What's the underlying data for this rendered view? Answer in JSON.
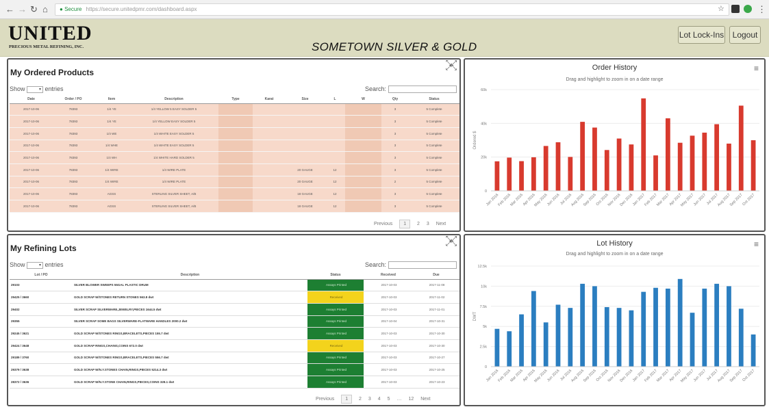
{
  "browser": {
    "secure_label": "Secure",
    "url": "https://secure.unitedpmr.com/dashboard.aspx"
  },
  "header": {
    "logo": "UNITED",
    "logo_sub": "PRECIOUS METAL REFINING, INC.",
    "store_name": "SOMETOWN SILVER & GOLD",
    "lot_lockins_btn": "Lot Lock-Ins",
    "logout_btn": "Logout"
  },
  "products": {
    "title": "My Ordered Products",
    "show_label": "Show",
    "entries_label": "entries",
    "search_label": "Search:",
    "columns": [
      "Date",
      "Order / PO",
      "Item",
      "Description",
      "Type",
      "Karat",
      "Size",
      "L",
      "W",
      "Qty",
      "Status"
    ],
    "rows": [
      [
        "2017-10-06",
        "78393",
        "1/4 YE",
        "1/4 YELLOW 5 EASY SOLDER 5",
        "",
        "",
        "",
        "",
        "",
        "3",
        "5 Complete"
      ],
      [
        "2017-10-06",
        "78393",
        "1/4 YE",
        "1/4 YELLOW EASY SOLDER 5",
        "",
        "",
        "",
        "",
        "",
        "3",
        "5 Complete"
      ],
      [
        "2017-10-06",
        "78393",
        "1/4 WE",
        "1/4 WHITE EASY SOLDER 5",
        "",
        "",
        "",
        "",
        "",
        "3",
        "5 Complete"
      ],
      [
        "2017-10-06",
        "78393",
        "1/4 WHE",
        "1/4 WHITE EASY SOLDER 5",
        "",
        "",
        "",
        "",
        "",
        "3",
        "5 Complete"
      ],
      [
        "2017-10-06",
        "78393",
        "1/4 WH",
        "1/4 WHITE HARD SOLDER 5",
        "",
        "",
        "",
        "",
        "",
        "3",
        "5 Complete"
      ],
      [
        "2017-10-06",
        "78393",
        "1/4 WIRE",
        "1/4 WIRE PLATE",
        "",
        "",
        "20 GAUGE",
        "12",
        "",
        "3",
        "5 Complete"
      ],
      [
        "2017-10-06",
        "78393",
        "1/4 WIRE",
        "1/4 WIRE PLATE",
        "",
        "",
        "20 GAUGE",
        "12",
        "",
        "2",
        "5 Complete"
      ],
      [
        "2017-10-06",
        "78393",
        "AGSS",
        "STERLING SILVER SHEET, A/B",
        "",
        "",
        "18 GAUGE",
        "12",
        "",
        "3",
        "5 Complete"
      ],
      [
        "2017-10-06",
        "78393",
        "AGSS",
        "STERLING SILVER SHEET, A/B",
        "",
        "",
        "18 GAUGE",
        "12",
        "",
        "3",
        "5 Complete"
      ]
    ],
    "pager": {
      "previous": "Previous",
      "pages": [
        "1",
        "2",
        "3"
      ],
      "next": "Next"
    }
  },
  "lots": {
    "title": "My Refining Lots",
    "show_label": "Show",
    "entries_label": "entries",
    "search_label": "Search:",
    "columns": [
      "Lot / PO",
      "Description",
      "Status",
      "Received",
      "Due"
    ],
    "rows": [
      [
        "29103",
        "SILVER BLOWER SWEEPS 55GAL PLASTIC DRUM",
        "Assays Printed",
        "2017-10-03",
        "2017-11-08"
      ],
      [
        "29425 / 3660",
        "GOLD SCRAP W/STONES RETURN STONES 563.8 dwt",
        "Received",
        "2017-10-03",
        "2017-11-02"
      ],
      [
        "29402",
        "SILVER SCRAP SILVERWARE,JEWELRY,PIECES 1644.5 dwt",
        "Assays Printed",
        "2017-10-03",
        "2017-11-01"
      ],
      [
        "29355",
        "SILVER SCRAP SOME BAGS SILVERWARE-FLATWARE HANDLES 2000.2 dwt",
        "Assays Printed",
        "2017-10-04",
        "2017-10-31"
      ],
      [
        "29245 / 3621",
        "GOLD SCRAP W/STONES RINGS,BRACELETS,PIECES 155.7 dwt",
        "Assays Printed",
        "2017-10-03",
        "2017-10-30"
      ],
      [
        "29424 / 3648",
        "GOLD SCRAP RINGS,CHAINS,COINS 672.0 dwt",
        "Received",
        "2017-10-03",
        "2017-10-30"
      ],
      [
        "29189 / 3760",
        "GOLD SCRAP W/STONES RINGS,BRACELETS,PIECES 556.7 dwt",
        "Assays Printed",
        "2017-10-03",
        "2017-10-27"
      ],
      [
        "29379 / 3638",
        "GOLD SCRAP W/N.Y.STONES CHAIN,RINGS,PIECES 5214.3 dwt",
        "Assays Printed",
        "2017-10-03",
        "2017-10-25"
      ],
      [
        "28372 / 3636",
        "GOLD SCRAP W/N.Y.STONE CHAIN,RINGS,PIECES,COINS 328.1 dwt",
        "Assays Printed",
        "2017-10-03",
        "2017-10-23"
      ]
    ],
    "pager": {
      "previous": "Previous",
      "pages": [
        "1",
        "2",
        "3",
        "4",
        "5",
        "…",
        "12"
      ],
      "next": "Next"
    }
  },
  "colors": {
    "order_bar": "#d83a2e",
    "lot_bar": "#2b7ec0",
    "green_status": "#1d7f32",
    "yellow_status": "#f3d31c"
  },
  "chart_data": [
    {
      "type": "bar",
      "title": "Order History",
      "subtitle": "Drag and highlight to zoom in on a date range",
      "ylabel": "Ordered $",
      "ylim": [
        0,
        60000
      ],
      "yticks": [
        "0",
        "20k",
        "40k",
        "60k"
      ],
      "categories": [
        "Jan 2016",
        "Feb 2016",
        "Mar 2016",
        "Apr 2016",
        "May 2016",
        "Jun 2016",
        "Jul 2016",
        "Aug 2016",
        "Sep 2016",
        "Oct 2016",
        "Nov 2016",
        "Dec 2016",
        "Jan 2017",
        "Feb 2017",
        "Mar 2017",
        "Apr 2017",
        "May 2017",
        "Jun 2017",
        "Jul 2017",
        "Aug 2017",
        "Sep 2017",
        "Oct 2017"
      ],
      "values": [
        17500,
        19700,
        17600,
        19900,
        26600,
        28800,
        20100,
        40900,
        37500,
        24200,
        31000,
        27500,
        54800,
        21000,
        43000,
        28500,
        32700,
        34500,
        39500,
        28000,
        50500,
        30000
      ],
      "legend": "none"
    },
    {
      "type": "bar",
      "title": "Lot History",
      "subtitle": "Drag and highlight to zoom in on a date range",
      "ylabel": "DWT",
      "ylim": [
        0,
        12500
      ],
      "yticks": [
        "0",
        "2.5k",
        "5k",
        "7.5k",
        "10k",
        "12.5k"
      ],
      "categories": [
        "Jan 2016",
        "Feb 2016",
        "Mar 2016",
        "Apr 2016",
        "May 2016",
        "Jun 2016",
        "Jul 2016",
        "Aug 2016",
        "Sep 2016",
        "Oct 2016",
        "Nov 2016",
        "Dec 2016",
        "Jan 2017",
        "Feb 2017",
        "Mar 2017",
        "Apr 2017",
        "May 2017",
        "Jun 2017",
        "Jul 2017",
        "Aug 2017",
        "Sep 2017",
        "Oct 2017"
      ],
      "values": [
        4700,
        4400,
        6500,
        9400,
        5500,
        7700,
        7300,
        10300,
        10000,
        7400,
        7300,
        7000,
        9300,
        9800,
        9700,
        10900,
        6700,
        9700,
        10300,
        10000,
        7200,
        4000
      ],
      "legend": "none"
    }
  ]
}
